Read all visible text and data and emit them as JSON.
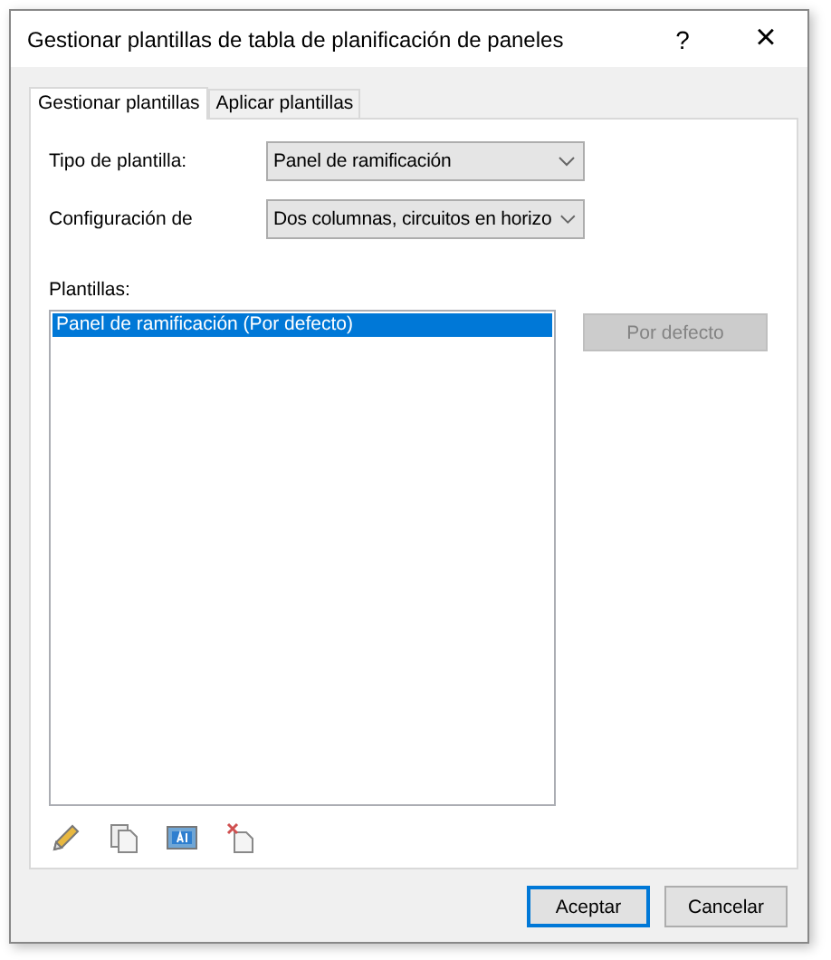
{
  "window": {
    "title": "Gestionar plantillas de tabla de planificación de paneles",
    "help": "?",
    "close": "×"
  },
  "tabs": [
    {
      "label": "Gestionar plantillas",
      "selected": true
    },
    {
      "label": "Aplicar plantillas",
      "selected": false
    }
  ],
  "fields": [
    {
      "label": "Tipo de plantilla:",
      "value": "Panel de ramificación"
    },
    {
      "label": "Configuración de",
      "value": "Dos columnas, circuitos en horizo"
    }
  ],
  "templates": {
    "label": "Plantillas:",
    "items": [
      {
        "text": "Panel de ramificación (Por defecto)",
        "selected": true
      }
    ],
    "default_button": {
      "label": "Por defecto",
      "disabled": true
    }
  },
  "toolbar": [
    {
      "kind": "edit"
    },
    {
      "kind": "duplicate"
    },
    {
      "kind": "rename"
    },
    {
      "kind": "delete"
    }
  ],
  "buttons": [
    {
      "label": "Aceptar",
      "default": true
    },
    {
      "label": "Cancelar",
      "default": false
    }
  ]
}
